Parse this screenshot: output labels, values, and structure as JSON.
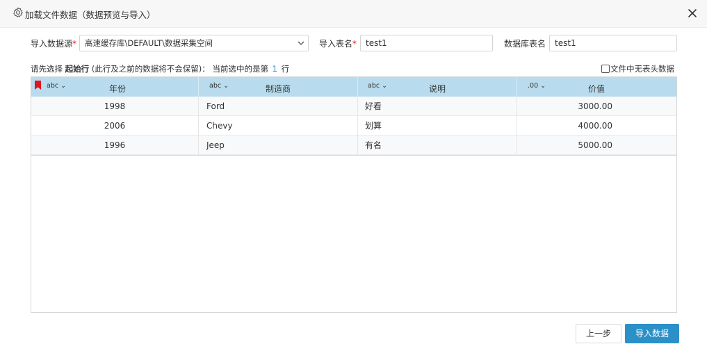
{
  "dialog": {
    "title": "加载文件数据（数据预览与导入）",
    "icons": {
      "title": "gear-icon",
      "close": "close-icon"
    }
  },
  "form": {
    "source_label": "导入数据源",
    "source_value": "高速缓存库\\DEFAULT\\数据采集空间",
    "table_label": "导入表名",
    "table_value": "test1",
    "db_table_label": "数据库表名",
    "db_table_value": "test1",
    "required_mark": "*"
  },
  "hint": {
    "prefix": "请先选择",
    "bold": "起始行",
    "middle": "(此行及之前的数据将不会保留)： 当前选中的是第",
    "row_number": "1",
    "suffix": "行"
  },
  "no_header_option": {
    "label": "文件中无表头数据",
    "checked": false
  },
  "grid": {
    "columns": [
      {
        "type": "abc ⌄",
        "name": "年份"
      },
      {
        "type": "abc ⌄",
        "name": "制造商"
      },
      {
        "type": "abc ⌄",
        "name": "说明"
      },
      {
        "type": ".00 ⌄",
        "name": "价值"
      }
    ],
    "rows": [
      [
        "1998",
        "Ford",
        "好看",
        "3000.00"
      ],
      [
        "2006",
        "Chevy",
        "划算",
        "4000.00"
      ],
      [
        "1996",
        "Jeep",
        "有名",
        "5000.00"
      ]
    ],
    "header_color": "#b8dced",
    "flag_color": "#e0141e"
  },
  "buttons": {
    "prev": "上一步",
    "import": "导入数据"
  },
  "colors": {
    "primary": "#2b90c8",
    "required": "#e02020",
    "highlight_number": "#2f8fd8"
  }
}
